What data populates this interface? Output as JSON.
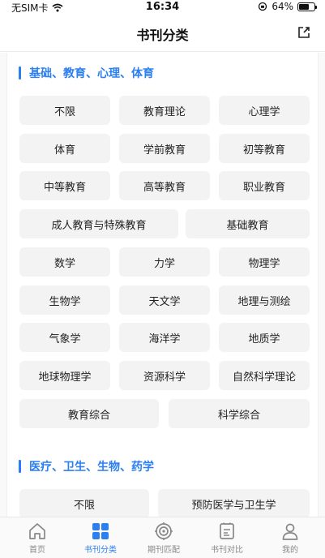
{
  "status_bar": {
    "carrier": "无SIM卡",
    "time": "16:34",
    "battery_percent": "64%",
    "battery_level": 0.64
  },
  "nav": {
    "title": "书刊分类"
  },
  "sections": [
    {
      "title": "基础、教育、心理、体育",
      "items": [
        "不限",
        "教育理论",
        "心理学",
        "体育",
        "学前教育",
        "初等教育",
        "中等教育",
        "高等教育",
        "职业教育",
        "成人教育与特殊教育",
        "基础教育",
        "数学",
        "力学",
        "物理学",
        "生物学",
        "天文学",
        "地理与测绘",
        "气象学",
        "海洋学",
        "地质学",
        "地球物理学",
        "资源科学",
        "自然科学理论",
        "教育综合",
        "科学综合"
      ]
    },
    {
      "title": "医疗、卫生、生物、药学",
      "items": [
        "不限",
        "预防医学与卫生学"
      ]
    }
  ],
  "tabs": [
    {
      "label": "首页",
      "icon": "home-icon",
      "active": false
    },
    {
      "label": "书刊分类",
      "icon": "grid-icon",
      "active": true
    },
    {
      "label": "期刊匹配",
      "icon": "target-icon",
      "active": false
    },
    {
      "label": "书刊对比",
      "icon": "compare-icon",
      "active": false
    },
    {
      "label": "我的",
      "icon": "user-icon",
      "active": false
    }
  ],
  "colors": {
    "accent": "#2c7ff0",
    "chip_bg": "#f3f3f3",
    "inactive": "#888888"
  }
}
